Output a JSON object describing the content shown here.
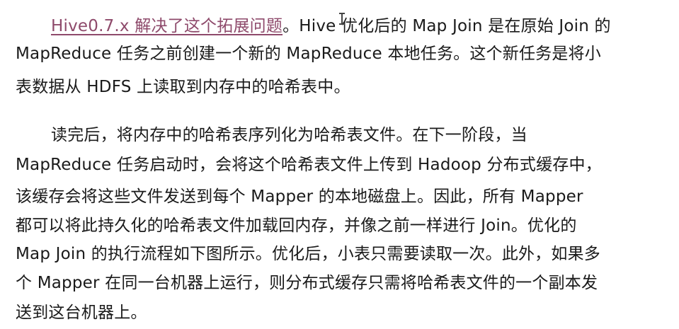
{
  "paragraph1": {
    "link_text": "Hive0.7.x 解决了这个拓展问题",
    "line1_rest": "。Hive 优化后的 Map Join 是在原始 Join 的",
    "line2": "MapReduce 任务之前创建一个新的 MapReduce 本地任务。这个新任务是将小",
    "line3": "表数据从 HDFS 上读取到内存中的哈希表中。"
  },
  "paragraph2": {
    "line1": "读完后，将内存中的哈希表序列化为哈希表文件。在下一阶段，当",
    "line2": "MapReduce 任务启动时，会将这个哈希表文件上传到 Hadoop 分布式缓存中，",
    "line3": "该缓存会将这些文件发送到每个 Mapper 的本地磁盘上。因此，所有 Mapper",
    "line4": "都可以将此持久化的哈希表文件加载回内存，并像之前一样进行 Join。优化的",
    "line5": "Map Join 的执行流程如下图所示。优化后，小表只需要读取一次。此外，如果多",
    "line6": "个 Mapper 在同一台机器上运行，则分布式缓存只需将哈希表文件的一个副本发",
    "line7": "送到这台机器上。"
  },
  "colors": {
    "text": "#1a1a1a",
    "link": "#8e4a6b",
    "background": "#ffffff"
  },
  "icons": {
    "cursor": "text-cursor-icon"
  }
}
